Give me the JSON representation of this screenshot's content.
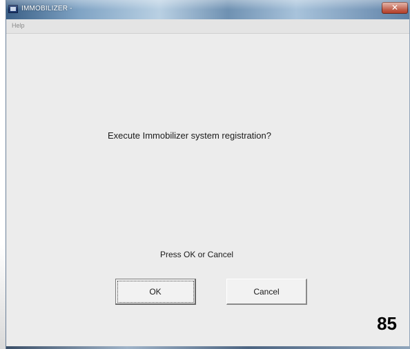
{
  "window": {
    "title": "IMMOBILIZER -",
    "close_label": "✕"
  },
  "menu": {
    "items": [
      {
        "label": "Help"
      }
    ]
  },
  "dialog": {
    "prompt": "Execute Immobilizer system registration?",
    "instruction": "Press OK or Cancel",
    "ok_label": "OK",
    "cancel_label": "Cancel"
  },
  "page_number": "85",
  "icons": {
    "app": "app-icon",
    "close": "close-icon"
  }
}
